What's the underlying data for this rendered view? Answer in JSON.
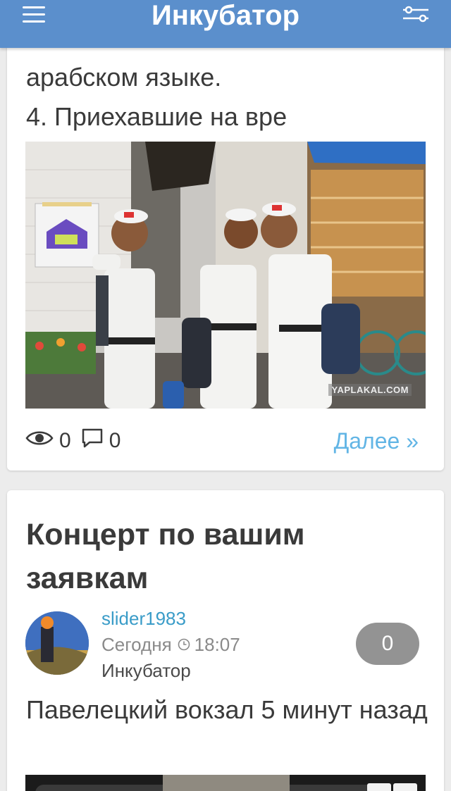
{
  "header": {
    "title": "Инкубатор",
    "menu_icon": "hamburger-menu-icon",
    "filter_icon": "sliders-icon",
    "bg_color": "#5b8fcc"
  },
  "post1": {
    "excerpt_lines": [
      "арабском языке.",
      "4. Приехавшие на вре"
    ],
    "photo_watermark": "YAPLAKAL.COM",
    "views": "0",
    "comments": "0",
    "more_label": "Далее »"
  },
  "post2": {
    "title": "Концерт по вашим заявкам",
    "author": "slider1983",
    "date_label": "Сегодня",
    "time": "18:07",
    "category": "Инкубатор",
    "comment_count": "0",
    "text": "Павелецкий вокзал 5 минут назад"
  },
  "colors": {
    "link": "#62b5e5",
    "author": "#3a9cc8",
    "pill": "#939393"
  }
}
